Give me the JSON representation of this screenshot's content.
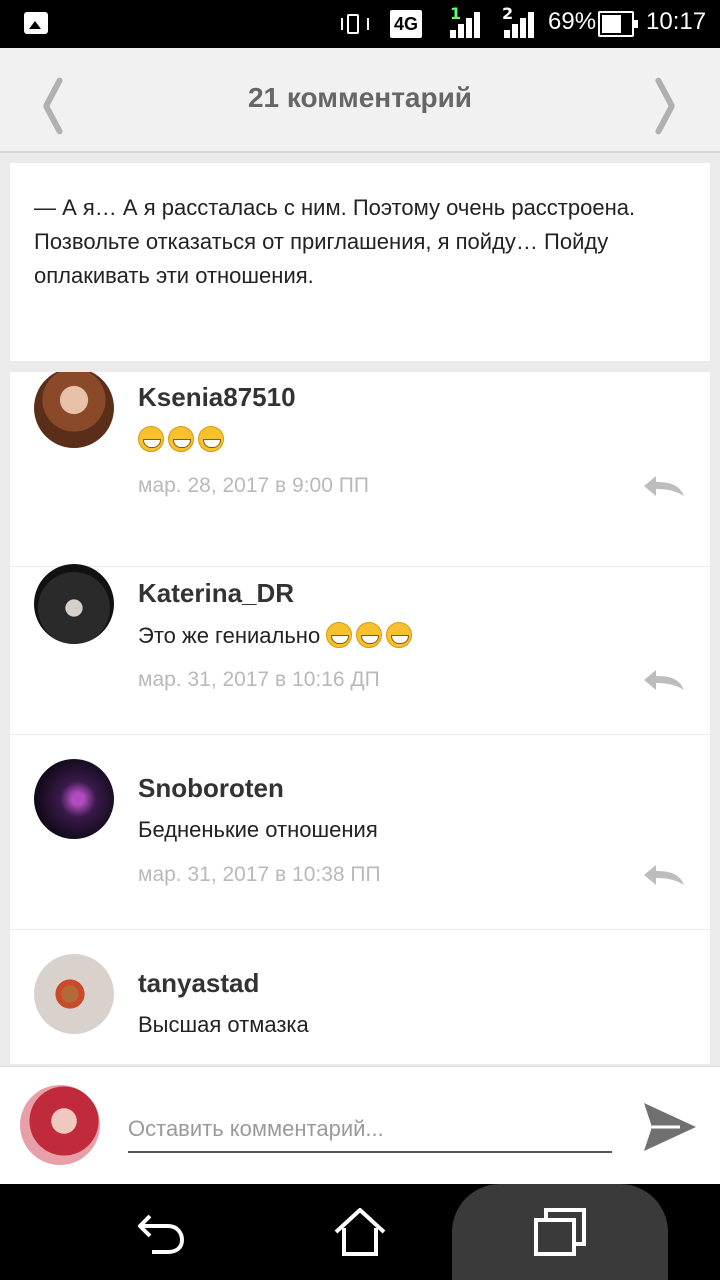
{
  "status_bar": {
    "network": "4G",
    "sim1": "1",
    "sim2": "2",
    "battery_percent": "69%",
    "battery_level": 0.69,
    "time": "10:17",
    "icons": [
      "image-icon",
      "vibrate-icon",
      "signal-icon",
      "battery-icon"
    ]
  },
  "header": {
    "title": "21 комментарий",
    "icons": [
      "chevron-left-icon",
      "chevron-right-icon"
    ]
  },
  "post": {
    "text": "— А я… А я рассталась с ним. Поэтому очень расстроена. Позвольте отказаться от приглашения, я пойду… Пойду оплакивать эти отношения."
  },
  "comments": [
    {
      "author": "Ksenia87510",
      "text": "",
      "emoji_count": 3,
      "date": "мар. 28, 2017 в 9:00 ПП"
    },
    {
      "author": "Katerina_DR",
      "text": "Это же гениально",
      "emoji_count": 3,
      "date": "мар. 31, 2017 в 10:16 ДП"
    },
    {
      "author": "Snoboroten",
      "text": "Бедненькие отношения",
      "emoji_count": 0,
      "date": "мар. 31, 2017 в 10:38 ПП"
    },
    {
      "author": "tanyastad",
      "text": "Высшая отмазка",
      "emoji_count": 0,
      "date": ""
    }
  ],
  "composer": {
    "placeholder": "Оставить комментарий...",
    "value": ""
  },
  "nav": {
    "icons": [
      "back-icon",
      "home-icon",
      "recents-icon"
    ]
  },
  "colors": {
    "header_bg": "#f1f1f1",
    "title": "#666666",
    "date": "#b9b9b9",
    "icon_gray": "#b0b0b0"
  }
}
